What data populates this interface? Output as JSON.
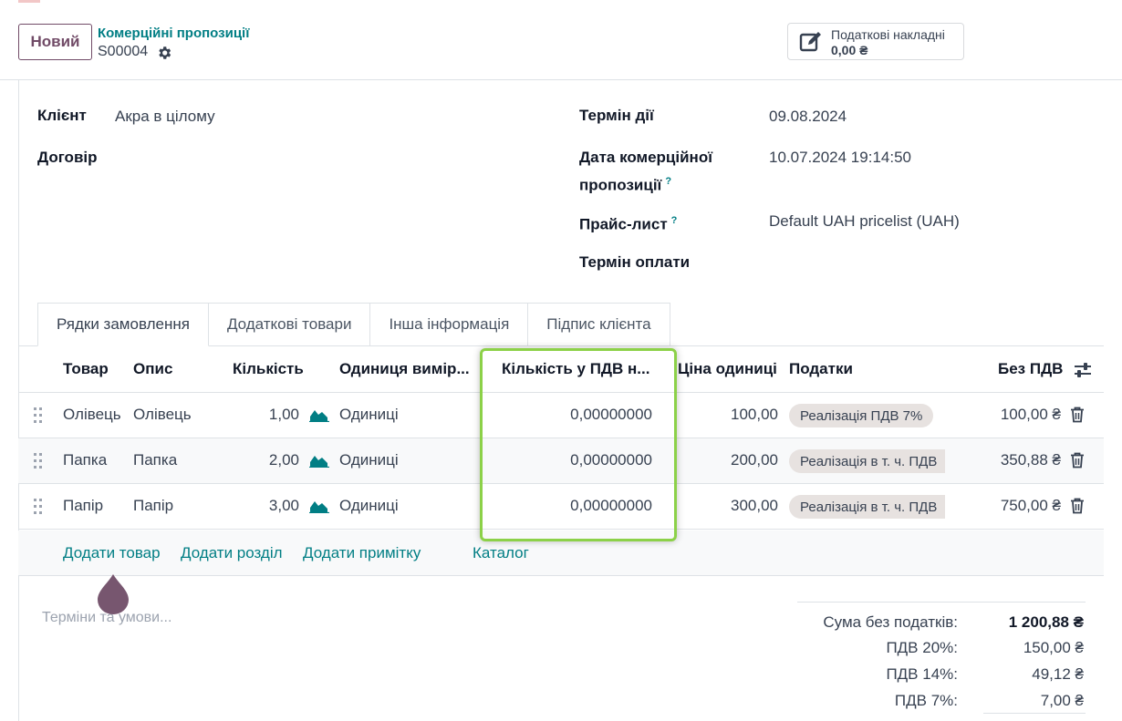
{
  "control_panel": {
    "new_button": "Новий",
    "breadcrumb": "Комерційні пропозиції",
    "record_name": "S00004",
    "smart_button": {
      "label": "Податкові накладні",
      "value": "0,00 ₴"
    }
  },
  "form": {
    "left": [
      {
        "label": "Клієнт",
        "value": "Акра в цілому"
      },
      {
        "label": "Договір",
        "value": ""
      }
    ],
    "right": {
      "validity_label": "Термін дії",
      "validity_value": "09.08.2024",
      "date_label_1": "Дата комерційної",
      "date_label_2": "пропозиції",
      "date_help": "?",
      "date_value": "10.07.2024 19:14:50",
      "pricelist_label": "Прайс-лист",
      "pricelist_help": "?",
      "pricelist_value": "Default UAH pricelist (UAH)",
      "payment_label": "Термін оплати"
    }
  },
  "tabs": [
    "Рядки замовлення",
    "Додаткові товари",
    "Інша інформація",
    "Підпис клієнта"
  ],
  "table": {
    "headers": {
      "product": "Товар",
      "description": "Опис",
      "quantity": "Кількість",
      "uom": "Одиниця вимір...",
      "qty_vat": "Кількість у ПДВ н...",
      "price": "Ціна одиниці",
      "taxes": "Податки",
      "subtotal": "Без ПДВ"
    },
    "rows": [
      {
        "product": "Олівець",
        "description": "Олівець",
        "quantity": "1,00",
        "uom": "Одиниці",
        "qty_vat": "0,00000000",
        "price": "100,00",
        "tax": "Реалізація ПДВ 7%",
        "subtotal": "100,00 ₴"
      },
      {
        "product": "Папка",
        "description": "Папка",
        "quantity": "2,00",
        "uom": "Одиниці",
        "qty_vat": "0,00000000",
        "price": "200,00",
        "tax": "Реалізація в т. ч. ПДВ",
        "subtotal": "350,88 ₴"
      },
      {
        "product": "Папір",
        "description": "Папір",
        "quantity": "3,00",
        "uom": "Одиниці",
        "qty_vat": "0,00000000",
        "price": "300,00",
        "tax": "Реалізація в т. ч. ПДВ",
        "subtotal": "750,00 ₴"
      }
    ],
    "add_links": {
      "add_product": "Додати товар",
      "add_section": "Додати розділ",
      "add_note": "Додати примітку",
      "catalog": "Каталог"
    }
  },
  "terms_placeholder": "Терміни та умови...",
  "totals": [
    {
      "label": "Сума без податків:",
      "value": "1 200,88 ₴"
    },
    {
      "label": "ПДВ 20%:",
      "value": "150,00 ₴"
    },
    {
      "label": "ПДВ 14%:",
      "value": "49,12 ₴"
    },
    {
      "label": "ПДВ 7%:",
      "value": "7,00 ₴"
    }
  ],
  "colors": {
    "brand": "#714b67",
    "link": "#017e84",
    "highlight": "#8cd148",
    "badge": "#e7e2e0"
  },
  "icons": [
    "gear-icon",
    "edit-document-icon",
    "drag-handle-icon",
    "forecast-chart-icon",
    "trash-icon",
    "column-settings-icon"
  ]
}
